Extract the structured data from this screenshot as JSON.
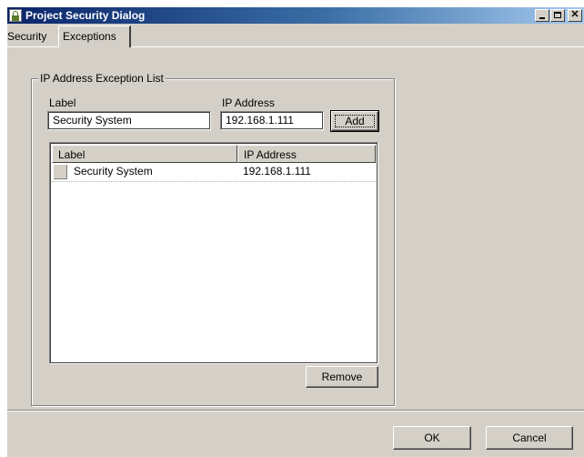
{
  "window": {
    "title": "Project Security Dialog"
  },
  "tabs": [
    {
      "label": "Security",
      "selected": false
    },
    {
      "label": "Exceptions",
      "selected": true
    }
  ],
  "exceptions": {
    "group_title": "IP Address Exception List",
    "label_field": {
      "label": "Label",
      "value": "Security System"
    },
    "ip_field": {
      "label": "IP Address",
      "value": "192.168.1.111"
    },
    "add_button": "Add",
    "list": {
      "columns": [
        "Label",
        "IP Address"
      ],
      "rows": [
        {
          "label": "Security System",
          "ip": "192.168.1.111"
        }
      ]
    },
    "remove_button": "Remove"
  },
  "footer": {
    "ok_button": "OK",
    "cancel_button": "Cancel"
  },
  "icons": {
    "app": "lock-icon",
    "minimize": "minimize-icon",
    "maximize": "maximize-icon",
    "close": "close-icon"
  },
  "colors": {
    "face": "#d4d0c8",
    "titlebar_start": "#0a246a",
    "titlebar_end": "#a6caf0"
  }
}
